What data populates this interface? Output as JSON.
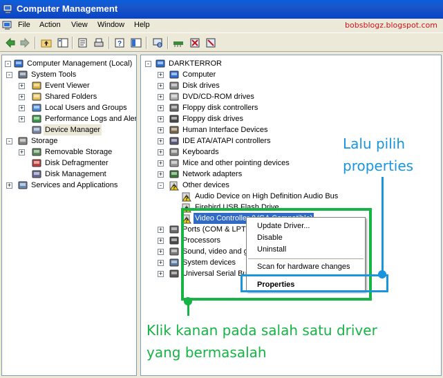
{
  "window": {
    "title": "Computer Management"
  },
  "menu": {
    "items": [
      "File",
      "Action",
      "View",
      "Window",
      "Help"
    ]
  },
  "watermark": "bobsblogz.blogspot.com",
  "toolbar": {
    "icons": [
      "back-arrow-icon",
      "forward-arrow-icon",
      "up-folder-icon",
      "show-tree-icon",
      "properties-icon",
      "print-icon",
      "help-icon",
      "console-icon",
      "scan-hardware-icon",
      "update-driver-icon",
      "uninstall-icon",
      "disable-icon"
    ]
  },
  "left_tree": {
    "items": [
      {
        "label": "Computer Management (Local)",
        "icon": "computer-management-icon",
        "expand": "-"
      },
      {
        "label": "System Tools",
        "icon": "system-tools-icon",
        "expand": "-"
      },
      {
        "label": "Event Viewer",
        "icon": "event-viewer-icon",
        "expand": "+"
      },
      {
        "label": "Shared Folders",
        "icon": "shared-folders-icon",
        "expand": "+"
      },
      {
        "label": "Local Users and Groups",
        "icon": "users-icon",
        "expand": "+"
      },
      {
        "label": "Performance Logs and Alerts",
        "icon": "performance-icon",
        "expand": "+"
      },
      {
        "label": "Device Manager",
        "icon": "device-manager-icon",
        "expand": ""
      },
      {
        "label": "Storage",
        "icon": "storage-icon",
        "expand": "-"
      },
      {
        "label": "Removable Storage",
        "icon": "removable-storage-icon",
        "expand": "+"
      },
      {
        "label": "Disk Defragmenter",
        "icon": "defragmenter-icon",
        "expand": ""
      },
      {
        "label": "Disk Management",
        "icon": "disk-management-icon",
        "expand": ""
      },
      {
        "label": "Services and Applications",
        "icon": "services-icon",
        "expand": "+"
      }
    ]
  },
  "right_tree": {
    "items": [
      {
        "label": "DARKTERROR",
        "icon": "computer-icon",
        "expand": "-"
      },
      {
        "label": "Computer",
        "icon": "computer-icon",
        "expand": "+"
      },
      {
        "label": "Disk drives",
        "icon": "disk-drive-icon",
        "expand": "+"
      },
      {
        "label": "DVD/CD-ROM drives",
        "icon": "dvd-icon",
        "expand": "+"
      },
      {
        "label": "Floppy disk controllers",
        "icon": "controller-icon",
        "expand": "+"
      },
      {
        "label": "Floppy disk drives",
        "icon": "floppy-icon",
        "expand": "+"
      },
      {
        "label": "Human Interface Devices",
        "icon": "hid-icon",
        "expand": "+"
      },
      {
        "label": "IDE ATA/ATAPI controllers",
        "icon": "ide-icon",
        "expand": "+"
      },
      {
        "label": "Keyboards",
        "icon": "keyboard-icon",
        "expand": "+"
      },
      {
        "label": "Mice and other pointing devices",
        "icon": "mouse-icon",
        "expand": "+"
      },
      {
        "label": "Network adapters",
        "icon": "network-icon",
        "expand": "+"
      },
      {
        "label": "Other devices",
        "icon": "warning-icon",
        "expand": "-"
      },
      {
        "label": "Audio Device on High Definition Audio Bus",
        "icon": "warning-icon",
        "expand": ""
      },
      {
        "label": "Firebird USB Flash Drive",
        "icon": "warning-icon",
        "expand": ""
      },
      {
        "label": "Video Controller (VGA Compatible)",
        "icon": "warning-icon",
        "expand": ""
      },
      {
        "label": "Ports (COM & LPT)",
        "icon": "port-icon",
        "expand": "+"
      },
      {
        "label": "Processors",
        "icon": "processor-icon",
        "expand": "+"
      },
      {
        "label": "Sound, video and g",
        "icon": "sound-icon",
        "expand": "+"
      },
      {
        "label": "System devices",
        "icon": "system-devices-icon",
        "expand": "+"
      },
      {
        "label": "Universal Serial Bu",
        "icon": "usb-icon",
        "expand": "+"
      }
    ]
  },
  "context_menu": {
    "update_driver": "Update Driver...",
    "disable": "Disable",
    "uninstall": "Uninstall",
    "scan": "Scan for hardware changes",
    "properties": "Properties"
  },
  "annotations": {
    "blue_line1": "Lalu pilih",
    "blue_line2": "properties",
    "green_line1": "Klik kanan pada salah satu driver",
    "green_line2": "yang bermasalah"
  },
  "colors": {
    "annotation_green": "#16b345",
    "annotation_blue": "#1a95dc",
    "watermark_red": "#d0131b",
    "selection_blue": "#316ac5",
    "titlebar_blue": "#0a5fdc"
  }
}
